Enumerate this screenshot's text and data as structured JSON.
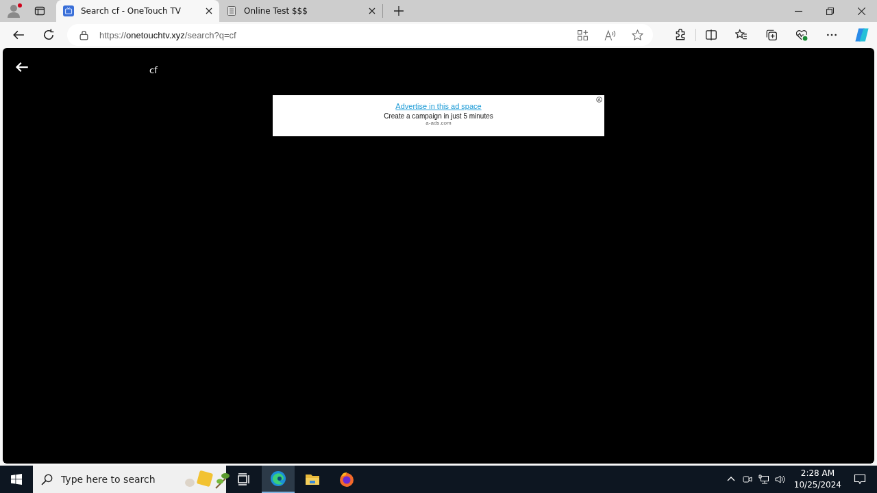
{
  "tabs": [
    {
      "title": "Search cf - OneTouch TV",
      "selected": true,
      "kind": "site"
    },
    {
      "title": "Online Test $$$",
      "selected": false,
      "kind": "doc"
    }
  ],
  "address": {
    "scheme": "https://",
    "host": "onetouchtv.xyz",
    "path": "/search?q=cf"
  },
  "page": {
    "query": "cf",
    "ad": {
      "link": "Advertise in this ad space",
      "text": "Create a campaign in just 5 minutes",
      "source": "a-ads.com"
    }
  },
  "taskbar": {
    "search": {
      "placeholder": "Type here to search"
    },
    "apps": [
      {
        "kind": "taskview",
        "selected": false
      },
      {
        "kind": "edge",
        "selected": true
      },
      {
        "kind": "folder",
        "selected": false
      },
      {
        "kind": "firefox",
        "selected": false
      }
    ],
    "time": "2:28 AM",
    "date": "10/25/2024"
  }
}
